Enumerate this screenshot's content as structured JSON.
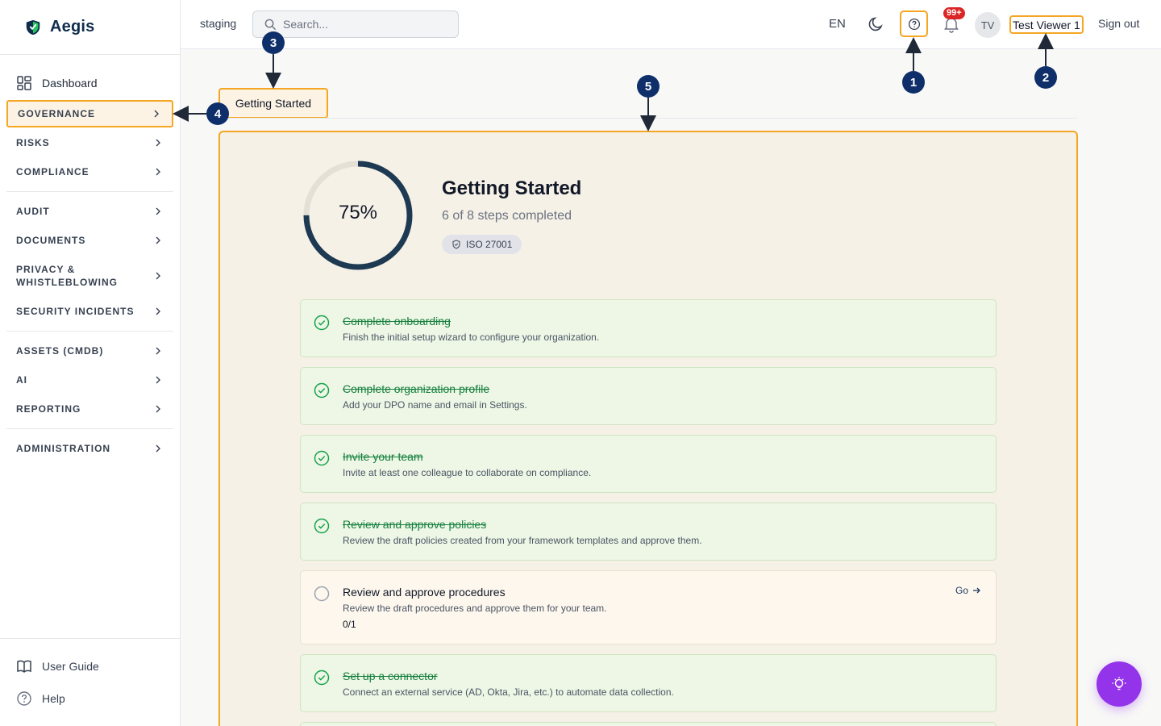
{
  "brand": {
    "name": "Aegis"
  },
  "sidebar": {
    "dashboard": "Dashboard",
    "items": [
      {
        "label": "GOVERNANCE"
      },
      {
        "label": "RISKS"
      },
      {
        "label": "COMPLIANCE"
      },
      {
        "label": "AUDIT"
      },
      {
        "label": "DOCUMENTS"
      },
      {
        "label": "PRIVACY & WHISTLEBLOWING"
      },
      {
        "label": "SECURITY INCIDENTS"
      },
      {
        "label": "ASSETS (CMDB)"
      },
      {
        "label": "AI"
      },
      {
        "label": "REPORTING"
      },
      {
        "label": "ADMINISTRATION"
      }
    ],
    "footer": {
      "user_guide": "User Guide",
      "help": "Help"
    }
  },
  "topbar": {
    "environment": "staging",
    "search_placeholder": "Search...",
    "language": "EN",
    "notifications_count": "99+",
    "avatar_initials": "TV",
    "username": "Test Viewer 1",
    "sign_out": "Sign out"
  },
  "tabs": [
    {
      "label": "Getting Started"
    }
  ],
  "getting_started": {
    "progress_percent": 75,
    "progress_label": "75%",
    "title": "Getting Started",
    "subtitle": "6 of 8 steps completed",
    "badge": "ISO 27001",
    "steps": [
      {
        "title": "Complete onboarding",
        "description": "Finish the initial setup wizard to configure your organization.",
        "done": true
      },
      {
        "title": "Complete organization profile",
        "description": "Add your DPO name and email in Settings.",
        "done": true
      },
      {
        "title": "Invite your team",
        "description": "Invite at least one colleague to collaborate on compliance.",
        "done": true
      },
      {
        "title": "Review and approve policies",
        "description": "Review the draft policies created from your framework templates and approve them.",
        "done": true
      },
      {
        "title": "Review and approve procedures",
        "description": "Review the draft procedures and approve them for your team.",
        "done": false,
        "progress": "0/1",
        "action": "Go"
      },
      {
        "title": "Set up a connector",
        "description": "Connect an external service (AD, Okta, Jira, etc.) to automate data collection.",
        "done": true
      }
    ]
  },
  "annotations": [
    "1",
    "2",
    "3",
    "4",
    "5"
  ],
  "colors": {
    "highlight": "#f5a623",
    "annotation": "#0f2f6b",
    "brand": "#0f2c4c",
    "success": "#15803d",
    "fab": "#9333ea"
  }
}
